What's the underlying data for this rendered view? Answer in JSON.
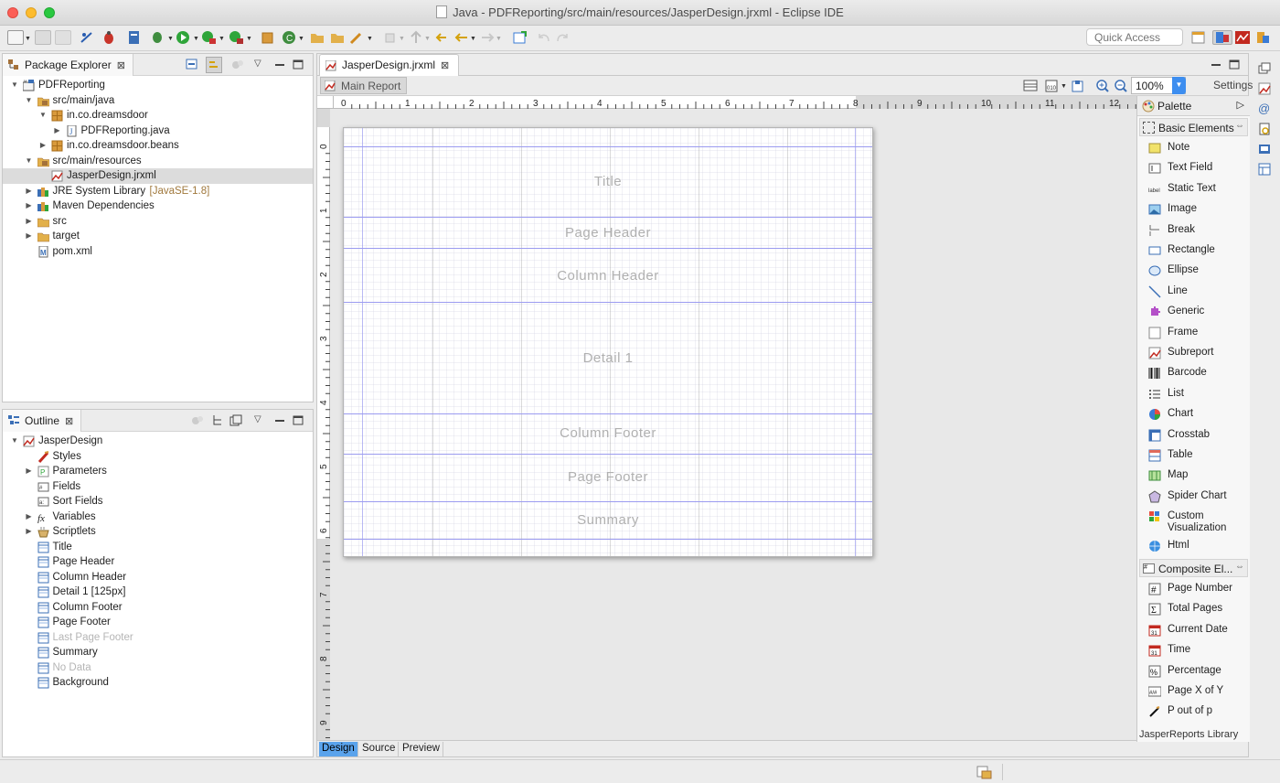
{
  "window": {
    "title": "Java - PDFReporting/src/main/resources/JasperDesign.jrxml - Eclipse IDE"
  },
  "toolbar": {
    "quick_access_placeholder": "Quick Access"
  },
  "package_explorer": {
    "title": "Package Explorer",
    "items": [
      {
        "label": "PDFReporting",
        "level": 0,
        "expanded": true,
        "icon": "project-icon"
      },
      {
        "label": "src/main/java",
        "level": 1,
        "expanded": true,
        "icon": "source-folder-icon"
      },
      {
        "label": "in.co.dreamsdoor",
        "level": 2,
        "expanded": true,
        "icon": "package-icon"
      },
      {
        "label": "PDFReporting.java",
        "level": 3,
        "expanded": false,
        "icon": "java-file-icon"
      },
      {
        "label": "in.co.dreamsdoor.beans",
        "level": 2,
        "expanded": false,
        "icon": "package-icon"
      },
      {
        "label": "src/main/resources",
        "level": 1,
        "expanded": true,
        "icon": "source-folder-icon"
      },
      {
        "label": "JasperDesign.jrxml",
        "level": 2,
        "selected": true,
        "icon": "jrxml-file-icon"
      },
      {
        "label": "JRE System Library",
        "suffix": "[JavaSE-1.8]",
        "level": 1,
        "expanded": false,
        "icon": "library-icon"
      },
      {
        "label": "Maven Dependencies",
        "level": 1,
        "expanded": false,
        "icon": "library-icon"
      },
      {
        "label": "src",
        "level": 1,
        "expanded": false,
        "icon": "folder-icon"
      },
      {
        "label": "target",
        "level": 1,
        "expanded": false,
        "icon": "folder-icon"
      },
      {
        "label": "pom.xml",
        "level": 1,
        "icon": "maven-file-icon"
      }
    ]
  },
  "outline": {
    "title": "Outline",
    "items": [
      {
        "label": "JasperDesign",
        "level": 0,
        "expanded": true,
        "icon": "jrxml-file-icon"
      },
      {
        "label": "Styles",
        "level": 1,
        "icon": "styles-icon"
      },
      {
        "label": "Parameters",
        "level": 1,
        "collapsed": true,
        "icon": "parameters-icon"
      },
      {
        "label": "Fields",
        "level": 1,
        "icon": "fields-icon"
      },
      {
        "label": "Sort Fields",
        "level": 1,
        "icon": "sort-fields-icon"
      },
      {
        "label": "Variables",
        "level": 1,
        "collapsed": true,
        "icon": "variables-icon"
      },
      {
        "label": "Scriptlets",
        "level": 1,
        "collapsed": true,
        "icon": "scriptlets-icon"
      },
      {
        "label": "Title",
        "level": 1,
        "icon": "band-icon"
      },
      {
        "label": "Page Header",
        "level": 1,
        "icon": "band-icon"
      },
      {
        "label": "Column Header",
        "level": 1,
        "icon": "band-icon"
      },
      {
        "label": "Detail 1 [125px]",
        "level": 1,
        "icon": "band-icon"
      },
      {
        "label": "Column Footer",
        "level": 1,
        "icon": "band-icon"
      },
      {
        "label": "Page Footer",
        "level": 1,
        "icon": "band-icon"
      },
      {
        "label": "Last Page Footer",
        "level": 1,
        "muted": true,
        "icon": "band-icon"
      },
      {
        "label": "Summary",
        "level": 1,
        "icon": "band-icon"
      },
      {
        "label": "No Data",
        "level": 1,
        "muted": true,
        "icon": "band-icon"
      },
      {
        "label": "Background",
        "level": 1,
        "icon": "band-icon"
      }
    ]
  },
  "editor": {
    "tab_label": "JasperDesign.jrxml",
    "main_report": "Main Report",
    "zoom": "100%",
    "settings": "Settings",
    "bands": [
      "Title",
      "Page Header",
      "Column Header",
      "Detail 1",
      "Column Footer",
      "Page Footer",
      "Summary"
    ],
    "bottom_tabs": [
      "Design",
      "Source",
      "Preview"
    ],
    "active_tab": "Design",
    "library_label": "JasperReports Library",
    "hruler_labels": [
      "0",
      "1",
      "2",
      "3",
      "4",
      "5",
      "6",
      "7",
      "8",
      "9",
      "10",
      "11",
      "12"
    ],
    "vruler_labels": [
      "0",
      "1",
      "2",
      "3",
      "4",
      "5",
      "6",
      "7",
      "8",
      "9"
    ]
  },
  "palette": {
    "title": "Palette",
    "basic_title": "Basic Elements",
    "basic": [
      {
        "label": "Note",
        "icon": "note-icon"
      },
      {
        "label": "Text Field",
        "icon": "text-field-icon"
      },
      {
        "label": "Static Text",
        "icon": "static-text-icon"
      },
      {
        "label": "Image",
        "icon": "image-icon"
      },
      {
        "label": "Break",
        "icon": "break-icon"
      },
      {
        "label": "Rectangle",
        "icon": "rectangle-icon"
      },
      {
        "label": "Ellipse",
        "icon": "ellipse-icon"
      },
      {
        "label": "Line",
        "icon": "line-icon"
      },
      {
        "label": "Generic",
        "icon": "generic-icon"
      },
      {
        "label": "Frame",
        "icon": "frame-icon"
      },
      {
        "label": "Subreport",
        "icon": "subreport-icon"
      },
      {
        "label": "Barcode",
        "icon": "barcode-icon"
      },
      {
        "label": "List",
        "icon": "list-icon"
      },
      {
        "label": "Chart",
        "icon": "chart-icon"
      },
      {
        "label": "Crosstab",
        "icon": "crosstab-icon"
      },
      {
        "label": "Table",
        "icon": "table-icon"
      },
      {
        "label": "Map",
        "icon": "map-icon"
      },
      {
        "label": "Spider Chart",
        "icon": "spider-chart-icon"
      },
      {
        "label": "Custom Visualization",
        "icon": "custom-visualization-icon"
      },
      {
        "label": "Html",
        "icon": "html-icon"
      }
    ],
    "composite_title": "Composite El...",
    "composite": [
      {
        "label": "Page Number",
        "icon": "page-number-icon"
      },
      {
        "label": "Total Pages",
        "icon": "total-pages-icon"
      },
      {
        "label": "Current Date",
        "icon": "current-date-icon"
      },
      {
        "label": "Time",
        "icon": "time-icon"
      },
      {
        "label": "Percentage",
        "icon": "percentage-icon"
      },
      {
        "label": "Page X of Y",
        "icon": "page-x-of-y-icon"
      },
      {
        "label": "P out of p",
        "icon": "p-out-of-p-icon"
      }
    ]
  }
}
